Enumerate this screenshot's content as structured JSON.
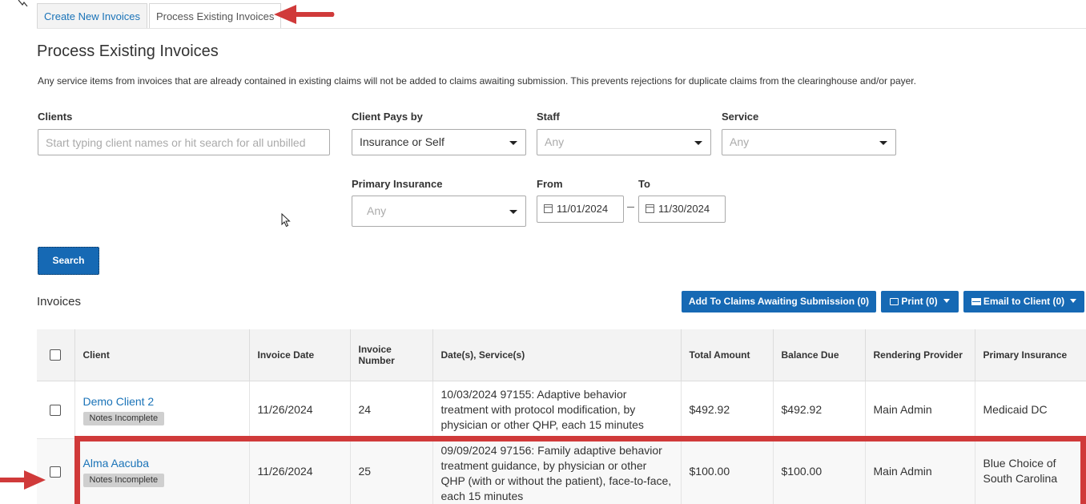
{
  "tabs": [
    {
      "label": "Create New Invoices"
    },
    {
      "label": "Process Existing Invoices"
    }
  ],
  "page": {
    "title": "Process Existing Invoices",
    "description": "Any service items from invoices that are already contained in existing claims will not be added to claims awaiting submission. This prevents rejections for duplicate claims from the clearinghouse and/or payer."
  },
  "filters": {
    "clients_label": "Clients",
    "clients_placeholder": "Start typing client names or hit search for all unbilled",
    "client_pays_label": "Client Pays by",
    "client_pays_value": "Insurance or Self",
    "staff_label": "Staff",
    "staff_value": "Any",
    "service_label": "Service",
    "service_value": "Any",
    "primary_insurance_label": "Primary Insurance",
    "primary_insurance_value": "Any",
    "from_label": "From",
    "from_value": "11/01/2024",
    "to_label": "To",
    "to_value": "11/30/2024",
    "search_button": "Search"
  },
  "invoices": {
    "title": "Invoices",
    "add_claims_button": "Add To Claims Awaiting Submission (0)",
    "print_button": "Print (0)",
    "email_button": "Email to Client (0)",
    "columns": {
      "client": "Client",
      "invoice_date": "Invoice Date",
      "invoice_number_1": "Invoice",
      "invoice_number_2": "Number",
      "dates_services": "Date(s), Service(s)",
      "total_amount": "Total Amount",
      "balance_due": "Balance Due",
      "rendering_provider": "Rendering Provider",
      "primary_insurance": "Primary Insurance"
    },
    "rows": [
      {
        "client": "Demo Client 2",
        "badge": "Notes Incomplete",
        "invoice_date": "11/26/2024",
        "invoice_number": "24",
        "service": "10/03/2024 97155: Adaptive behavior treatment with protocol modification, by physician or other QHP, each 15 minutes",
        "total_amount": "$492.92",
        "balance_due": "$492.92",
        "rendering_provider": "Main Admin",
        "primary_insurance": "Medicaid DC"
      },
      {
        "client": "Alma Aacuba",
        "badge": "Notes Incomplete",
        "invoice_date": "11/26/2024",
        "invoice_number": "25",
        "service": "09/09/2024 97156: Family adaptive behavior treatment guidance, by physician or other QHP (with or without the patient), face-to-face, each 15 minutes",
        "total_amount": "$100.00",
        "balance_due": "$100.00",
        "rendering_provider": "Main Admin",
        "primary_insurance": "Blue Choice of South Carolina"
      }
    ]
  },
  "colors": {
    "primary_blue": "#1669b4",
    "link_blue": "#1a73b8",
    "annotation_red": "#d03a3a"
  }
}
